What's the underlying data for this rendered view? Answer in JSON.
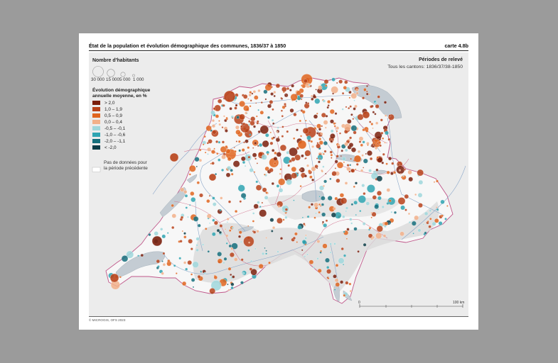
{
  "sheet": {
    "title": "État de la population et évolution démographique des communes, 1836/37 à 1850",
    "map_number": "carte 4.8b",
    "copyright": "© MICROGIS, OFS 2023"
  },
  "legend": {
    "size_title": "Nombre d'habitants",
    "size_classes": [
      "30 000",
      "15 000",
      "5 000",
      "1 000"
    ],
    "evolution_title_line1": "Évolution démographique",
    "evolution_title_line2": "annuelle moyenne, en %",
    "classes": [
      {
        "label": ">  2,0",
        "color": "#7a1f0c"
      },
      {
        "label": "1,0  –  1,9",
        "color": "#b8421a"
      },
      {
        "label": "0,5  –  0,9",
        "color": "#e0651f"
      },
      {
        "label": "0,0  –  0,4",
        "color": "#f2b089"
      },
      {
        "label": "-0,5  –  -0,1",
        "color": "#9fd7dc"
      },
      {
        "label": "-1,0  –  -0,6",
        "color": "#2fa5b2"
      },
      {
        "label": "-2,0  –  -1,1",
        "color": "#156f7c"
      },
      {
        "label": "<  -2,0",
        "color": "#0b3c47"
      }
    ],
    "nodata_line1": "Pas de données pour",
    "nodata_line2": "la période précédente"
  },
  "periods": {
    "title": "Périodes de relevé",
    "text": "Tous les cantons: 1836/37/38-1850"
  },
  "scale": {
    "start": "0",
    "end": "100 km"
  },
  "colors": {
    "lake": "#c4ccd3",
    "river": "#8aa7c9",
    "canton_border": "#d06a88",
    "national_border": "#c0578a"
  }
}
